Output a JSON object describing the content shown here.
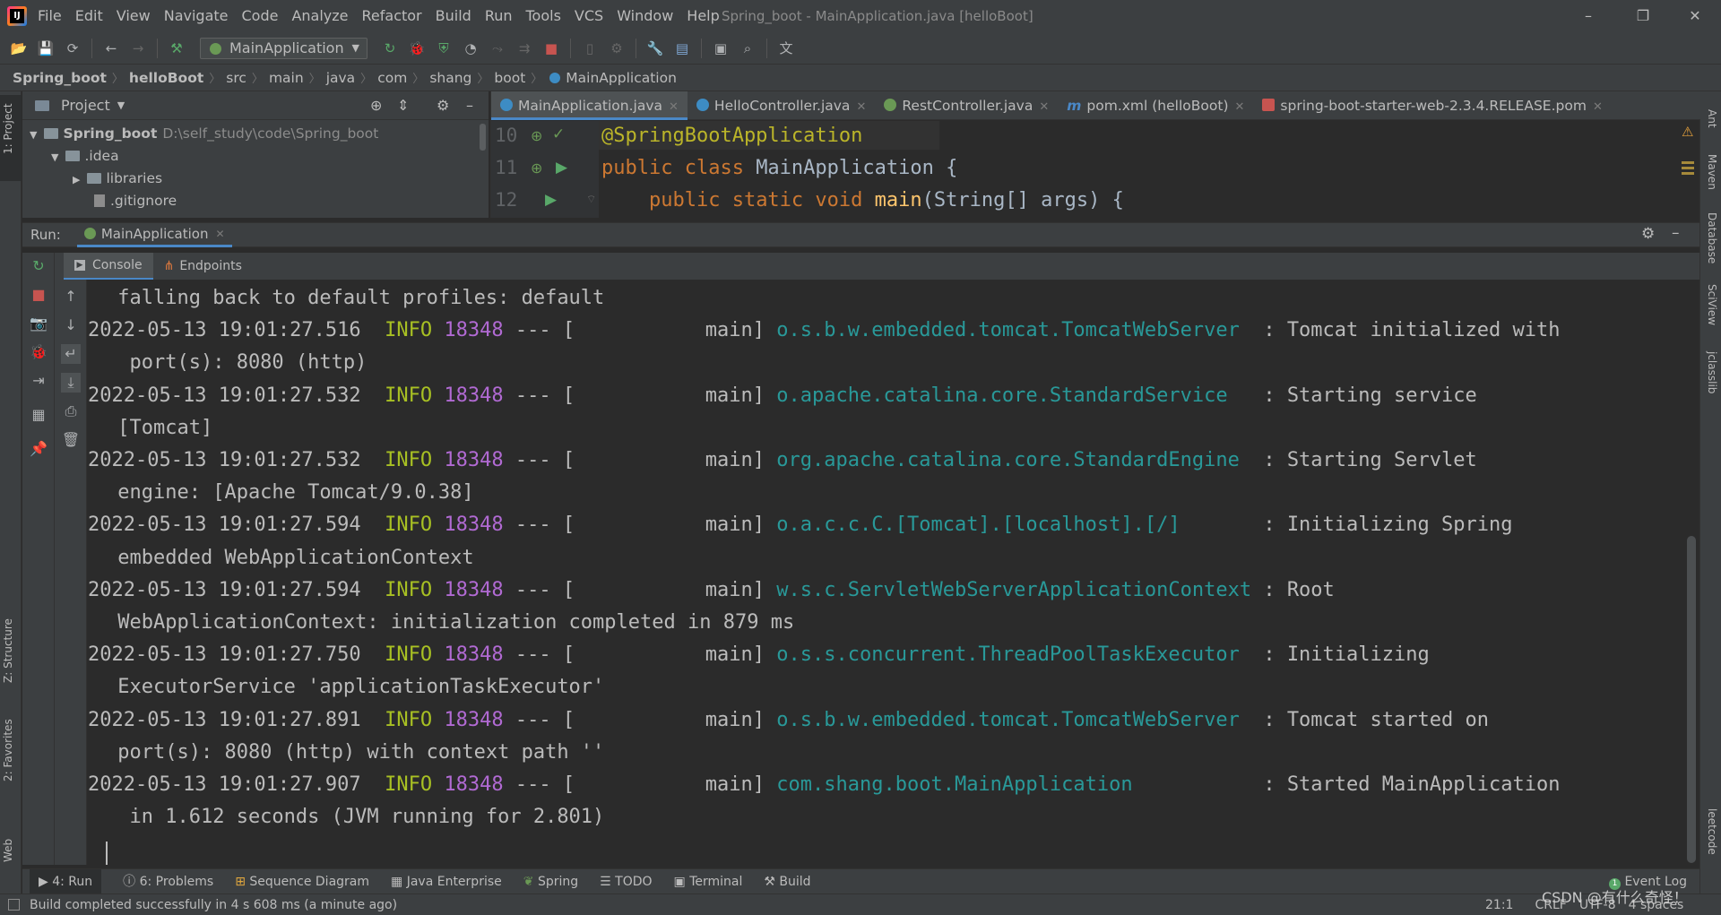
{
  "window": {
    "title": "Spring_boot - MainApplication.java [helloBoot]",
    "minimize": "–",
    "restore": "❐",
    "close": "✕"
  },
  "menu": [
    "File",
    "Edit",
    "View",
    "Navigate",
    "Code",
    "Analyze",
    "Refactor",
    "Build",
    "Run",
    "Tools",
    "VCS",
    "Window",
    "Help"
  ],
  "toolbar": {
    "run_config": "MainApplication"
  },
  "breadcrumbs": [
    "Spring_boot",
    "helloBoot",
    "src",
    "main",
    "java",
    "com",
    "shang",
    "boot",
    "MainApplication"
  ],
  "left_stripe": {
    "project_tab": "1: Project",
    "structure_tab": "Z: Structure",
    "favorites_tab": "2: Favorites",
    "web_tab": "Web"
  },
  "right_stripe": {
    "ant_tab": "Ant",
    "maven_tab": "Maven",
    "database_tab": "Database",
    "sciview_tab": "SciView",
    "jclasslib_tab": "jclasslib",
    "leetcode_tab": "leetcode"
  },
  "project_panel": {
    "title": "Project",
    "tree": [
      {
        "label": "Spring_boot",
        "path": "D:\\self_study\\code\\Spring_boot"
      },
      {
        "label": ".idea"
      },
      {
        "label": "libraries"
      },
      {
        "label": ".gitignore"
      }
    ]
  },
  "editor": {
    "tabs": [
      {
        "label": "MainApplication.java",
        "active": true
      },
      {
        "label": "HelloController.java"
      },
      {
        "label": "RestController.java"
      },
      {
        "label": "pom.xml (helloBoot)"
      },
      {
        "label": "spring-boot-starter-web-2.3.4.RELEASE.pom"
      }
    ],
    "line_numbers": [
      "10",
      "11",
      "12"
    ],
    "code": {
      "line10_annotation": "@SpringBootApplication",
      "line11_kw": "public class ",
      "line11_rest": "MainApplication {",
      "line12_indent": "    ",
      "line12_kw": "public static void ",
      "line12_fn": "main",
      "line12_rest": "(String[] args) {"
    }
  },
  "run_window": {
    "label": "Run:",
    "config_tab": "MainApplication",
    "console_tab": "Console",
    "endpoints_tab": "Endpoints"
  },
  "console": {
    "wrap_first": " falling back to default profiles: default",
    "entries": [
      {
        "ts": "2022-05-13 19:01:27.516",
        "level": "INFO",
        "pid": "18348",
        "sep": " --- [",
        "thread": "           main] ",
        "logger": "o.s.b.w.embedded.tomcat.TomcatWebServer ",
        "msg": " : Tomcat initialized with",
        "cont": "  port(s): 8080 (http)"
      },
      {
        "ts": "2022-05-13 19:01:27.532",
        "level": "INFO",
        "pid": "18348",
        "sep": " --- [",
        "thread": "           main] ",
        "logger": "o.apache.catalina.core.StandardService  ",
        "msg": " : Starting service",
        "cont": " [Tomcat]"
      },
      {
        "ts": "2022-05-13 19:01:27.532",
        "level": "INFO",
        "pid": "18348",
        "sep": " --- [",
        "thread": "           main] ",
        "logger": "org.apache.catalina.core.StandardEngine ",
        "msg": " : Starting Servlet",
        "cont": " engine: [Apache Tomcat/9.0.38]"
      },
      {
        "ts": "2022-05-13 19:01:27.594",
        "level": "INFO",
        "pid": "18348",
        "sep": " --- [",
        "thread": "           main] ",
        "logger": "o.a.c.c.C.[Tomcat].[localhost].[/]      ",
        "msg": " : Initializing Spring",
        "cont": " embedded WebApplicationContext"
      },
      {
        "ts": "2022-05-13 19:01:27.594",
        "level": "INFO",
        "pid": "18348",
        "sep": " --- [",
        "thread": "           main] ",
        "logger": "w.s.c.ServletWebServerApplicationContext",
        "msg": " : Root",
        "cont": " WebApplicationContext: initialization completed in 879 ms"
      },
      {
        "ts": "2022-05-13 19:01:27.750",
        "level": "INFO",
        "pid": "18348",
        "sep": " --- [",
        "thread": "           main] ",
        "logger": "o.s.s.concurrent.ThreadPoolTaskExecutor ",
        "msg": " : Initializing",
        "cont": " ExecutorService 'applicationTaskExecutor'"
      },
      {
        "ts": "2022-05-13 19:01:27.891",
        "level": "INFO",
        "pid": "18348",
        "sep": " --- [",
        "thread": "           main] ",
        "logger": "o.s.b.w.embedded.tomcat.TomcatWebServer ",
        "msg": " : Tomcat started on",
        "cont": " port(s): 8080 (http) with context path ''"
      },
      {
        "ts": "2022-05-13 19:01:27.907",
        "level": "INFO",
        "pid": "18348",
        "sep": " --- [",
        "thread": "           main] ",
        "logger": "com.shang.boot.MainApplication          ",
        "msg": " : Started MainApplication",
        "cont": "  in 1.612 seconds (JVM running for 2.801)"
      }
    ]
  },
  "bottom_tabs": [
    "4: Run",
    "6: Problems",
    "Sequence Diagram",
    "Java Enterprise",
    "Spring",
    "TODO",
    "Terminal",
    "Build"
  ],
  "event_log": "Event Log",
  "status": {
    "message": "Build completed successfully in 4 s 608 ms (a minute ago)",
    "position": "21:1",
    "line_sep": "CRLF",
    "encoding": "UTF-8",
    "indent": "4 spaces"
  },
  "watermark": "CSDN @有什么奇怪！",
  "colors": {
    "accent": "#4a88c7",
    "log_level": "#a8c023",
    "pid": "#b16ad3",
    "logger": "#299999",
    "keyword": "#cc7832",
    "annotation": "#bbb529"
  }
}
